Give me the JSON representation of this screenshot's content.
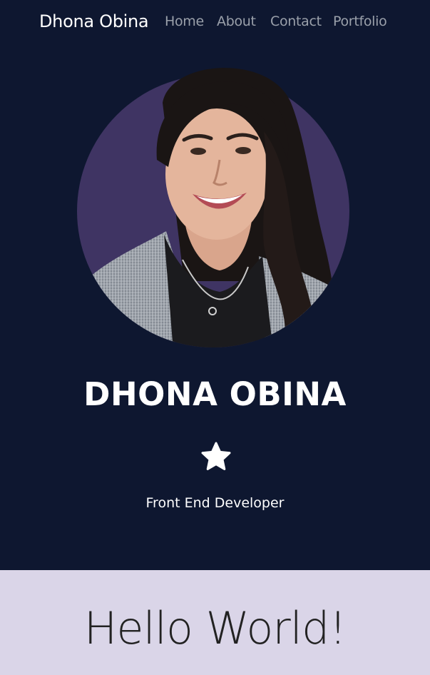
{
  "nav": {
    "brand": "Dhona Obina",
    "links": [
      "Home",
      "About",
      "Contact",
      "Portfolio"
    ]
  },
  "hero": {
    "name": "DHONA OBINA",
    "tagline": "Front End Developer",
    "star_icon": "star-icon"
  },
  "hello": {
    "heading": "Hello World!"
  },
  "colors": {
    "header_bg": "#0e1730",
    "avatar_bg": "#3f3463",
    "section_bg": "#dad5e8",
    "nav_link": "#9aa0aa"
  }
}
